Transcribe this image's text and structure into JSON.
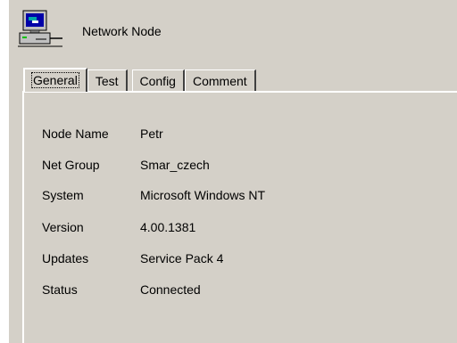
{
  "header": {
    "title": "Network Node",
    "icon": "network-computer-icon"
  },
  "tabs": [
    {
      "label": "General",
      "active": true
    },
    {
      "label": "Test",
      "active": false
    },
    {
      "label": "Config",
      "active": false
    },
    {
      "label": "Comment",
      "active": false
    }
  ],
  "general": {
    "fields": [
      {
        "label": "Node Name",
        "value": "Petr"
      },
      {
        "label": "Net Group",
        "value": "Smar_czech"
      },
      {
        "label": "System",
        "value": "Microsoft Windows NT"
      },
      {
        "label": "Version",
        "value": "4.00.1381"
      },
      {
        "label": "Updates",
        "value": "Service Pack 4"
      },
      {
        "label": "Status",
        "value": "Connected"
      }
    ]
  },
  "colors": {
    "face": "#d4d0c8",
    "highlight": "#ffffff",
    "shadow": "#404040"
  }
}
